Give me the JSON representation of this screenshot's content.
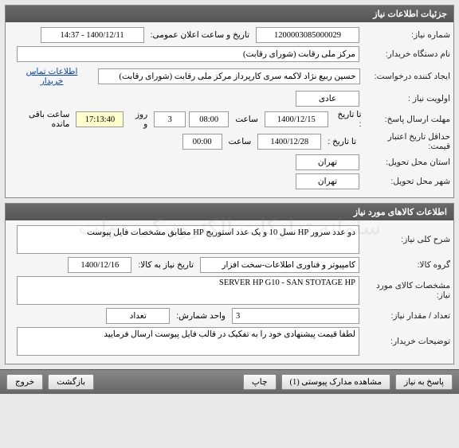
{
  "watermark": "سامانه تدارکات الکترونیکی دولت",
  "panel1": {
    "title": "جزئیات اطلاعات نیاز",
    "need_number_label": "شماره نیاز:",
    "need_number": "1200003085000029",
    "announce_label": "تاریخ و ساعت اعلان عمومی:",
    "announce_value": "1400/12/11 - 14:37",
    "buyer_org_label": "نام دستگاه خریدار:",
    "buyer_org": "مرکز ملی رقابت (شورای رقابت)",
    "creator_label": "ایجاد کننده درخواست:",
    "creator": "حسین ربیع نژاد لاکمه سری کارپرداز مرکز ملی رقابت (شورای رقابت)",
    "contact_btn": "اطلاعات تماس خریدار",
    "priority_label": "اولویت نیاز :",
    "priority": "عادی",
    "deadline_label": "مهلت ارسال پاسخ:",
    "to_date_label": "تا تاریخ :",
    "deadline_date": "1400/12/15",
    "time_label": "ساعت",
    "deadline_time": "08:00",
    "days_count": "3",
    "days_and": "روز و",
    "remaining_time": "17:13:40",
    "remaining_label": "ساعت باقی مانده",
    "min_validity_label": "حداقل تاریخ اعتبار قیمت:",
    "validity_date": "1400/12/28",
    "validity_time": "00:00",
    "province_label": "استان محل تحویل:",
    "province": "تهران",
    "city_label": "شهر محل تحویل:",
    "city": "تهران"
  },
  "panel2": {
    "title": "اطلاعات کالاهای مورد نیاز",
    "desc_label": "شرح کلی نیاز:",
    "desc": "دو عدد سرور HP نسل 10 و یک عدد استوریج HP مطابق مشخصات فایل پیوست",
    "group_label": "گروه کالا:",
    "group": "کامپیوتر و فناوری اطلاعات-سخت افزار",
    "need_date_label": "تاریخ نیاز به کالا:",
    "need_date": "1400/12/16",
    "spec_label": "مشخصات کالای مورد نیاز:",
    "spec": "SERVER HP G10 - SAN STOTAGE HP",
    "qty_label": "تعداد / مقدار نیاز:",
    "qty": "3",
    "unit_label": "واحد شمارش:",
    "unit": "تعداد",
    "buyer_notes_label": "توضیحات خریدار:",
    "buyer_notes": "لطفا قیمت پیشنهادی خود را به تفکیک در قالب فایل پیوست ارسال فرمایید"
  },
  "footer": {
    "reply": "پاسخ به نیاز",
    "attachments": "مشاهده مدارک پیوستی (1)",
    "print": "چاپ",
    "back": "بازگشت",
    "exit": "خروج"
  }
}
